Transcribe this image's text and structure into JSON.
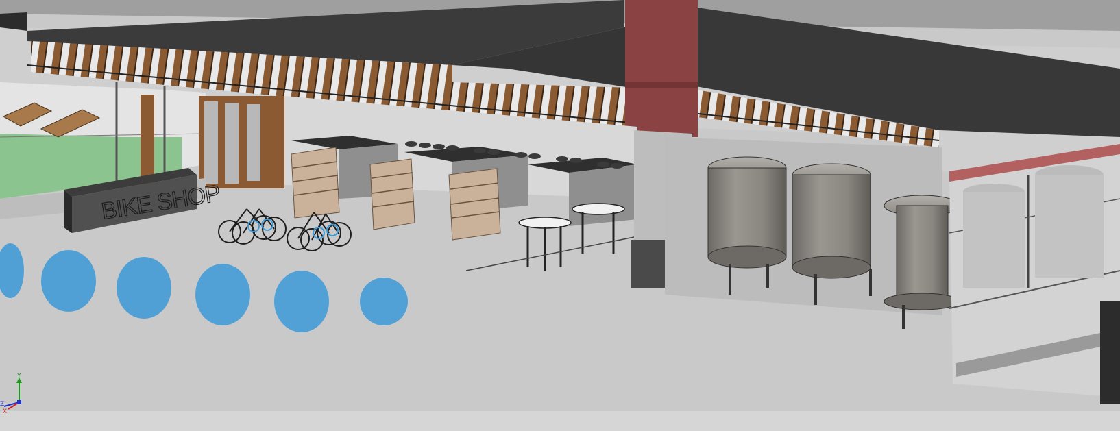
{
  "app": {
    "view_type": "3D CAD model viewport",
    "background_color": "#c8c8c8"
  },
  "scene": {
    "sign_text": "BIKE SHOP",
    "accent_colors": {
      "ceiling": "#3a3a3a",
      "wood_slats": "#8a5a33",
      "turf": "#8cc48f",
      "red_column": "#8a4242",
      "tank": "#8e8a85",
      "plants": "#3d9ad8"
    }
  },
  "triad": {
    "y_label": "Y",
    "z_label": "Z",
    "x_label": "X",
    "icon": "coordinate-axes-icon"
  }
}
